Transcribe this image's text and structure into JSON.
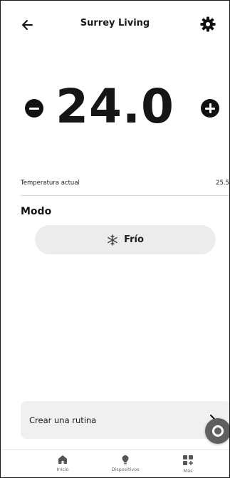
{
  "header": {
    "title": "Surrey Living"
  },
  "control": {
    "setpoint": "24.0"
  },
  "current": {
    "label": "Temperatura actual",
    "value": "25.5"
  },
  "mode": {
    "heading": "Modo",
    "label": "Frío",
    "icon": "snowflake-icon"
  },
  "routine": {
    "label": "Crear una rutina"
  },
  "nav": {
    "items": [
      {
        "label": "Inicio",
        "icon": "home-icon"
      },
      {
        "label": "Dispositivos",
        "icon": "lightbulb-icon"
      },
      {
        "label": "Más",
        "icon": "grid-plus-icon"
      }
    ]
  },
  "colors": {
    "accent": "#111111",
    "pill": "#ececec",
    "card": "#f0f0f0",
    "fab": "#5f5f5f"
  }
}
